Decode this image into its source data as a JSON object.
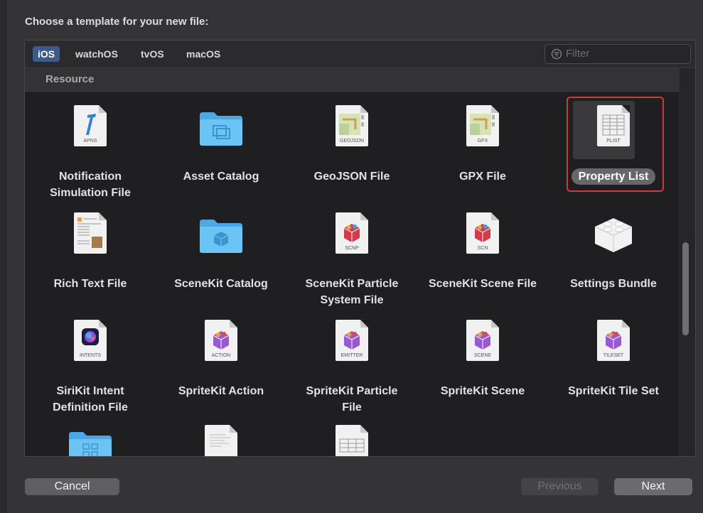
{
  "dialog": {
    "title": "Choose a template for your new file:"
  },
  "platform_tabs": [
    {
      "label": "iOS",
      "active": true
    },
    {
      "label": "watchOS",
      "active": false
    },
    {
      "label": "tvOS",
      "active": false
    },
    {
      "label": "macOS",
      "active": false
    }
  ],
  "filter": {
    "placeholder": "Filter",
    "icon": "filter-icon"
  },
  "section": {
    "title": "Resource"
  },
  "templates": [
    {
      "label": "Notification Simulation File",
      "icon": "apns-file-icon",
      "ext": "APNS"
    },
    {
      "label": "Asset Catalog",
      "icon": "folder-icon",
      "ext": ""
    },
    {
      "label": "GeoJSON File",
      "icon": "map-file-icon",
      "ext": "GEOJSON"
    },
    {
      "label": "GPX File",
      "icon": "map-file-icon",
      "ext": "GPX"
    },
    {
      "label": "Property List",
      "icon": "plist-file-icon",
      "ext": "PLIST",
      "selected": true
    },
    {
      "label": "Rich Text File",
      "icon": "rich-text-file-icon",
      "ext": ""
    },
    {
      "label": "SceneKit Catalog",
      "icon": "folder-icon",
      "ext": ""
    },
    {
      "label": "SceneKit Particle System File",
      "icon": "scenekit-file-icon",
      "ext": "SCNP"
    },
    {
      "label": "SceneKit Scene File",
      "icon": "scenekit-file-icon",
      "ext": "SCN"
    },
    {
      "label": "Settings Bundle",
      "icon": "lego-brick-icon",
      "ext": ""
    },
    {
      "label": "SiriKit Intent Definition File",
      "icon": "intents-file-icon",
      "ext": "INTENTS"
    },
    {
      "label": "SpriteKit Action",
      "icon": "spritekit-file-icon",
      "ext": "ACTION"
    },
    {
      "label": "SpriteKit Particle File",
      "icon": "spritekit-file-icon",
      "ext": "EMITTER"
    },
    {
      "label": "SpriteKit Scene",
      "icon": "spritekit-file-icon",
      "ext": "SCENE"
    },
    {
      "label": "SpriteKit Tile Set",
      "icon": "spritekit-file-icon",
      "ext": "TILESET"
    }
  ],
  "buttons": {
    "cancel": "Cancel",
    "previous": "Previous",
    "next": "Next"
  },
  "colors": {
    "selection_outline": "#d8343b",
    "active_tab": "#3c5a8a",
    "folder_blue": "#5ab8f0"
  }
}
